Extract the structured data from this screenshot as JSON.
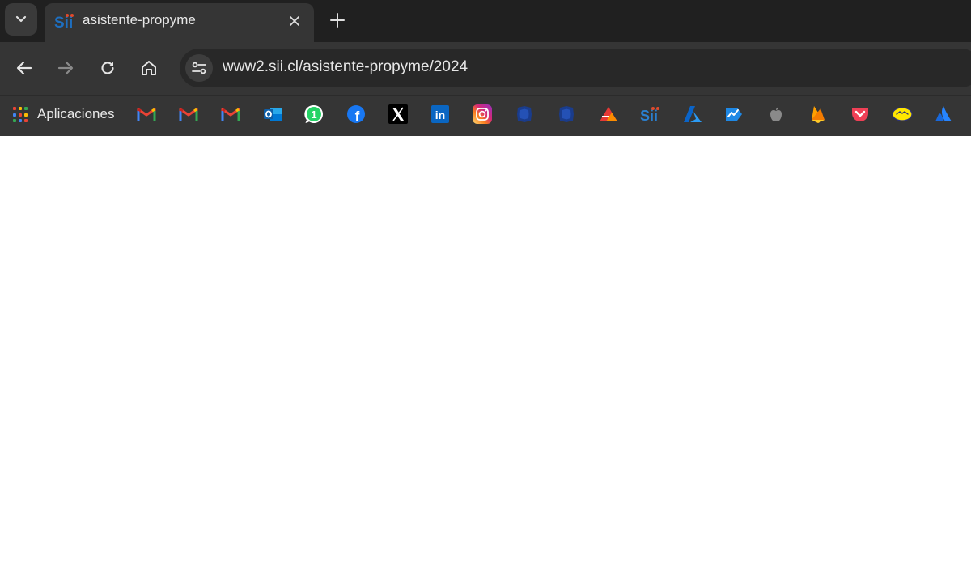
{
  "tab": {
    "title": "asistente-propyme",
    "favicon_text": "Sii"
  },
  "toolbar": {
    "url": "www2.sii.cl/asistente-propyme/2024"
  },
  "bookmarks": {
    "apps_label": "Aplicaciones",
    "items": [
      {
        "icon": "gmail-icon"
      },
      {
        "icon": "gmail-icon"
      },
      {
        "icon": "gmail-icon"
      },
      {
        "icon": "outlook-icon"
      },
      {
        "icon": "whatsapp-icon",
        "badge": "1"
      },
      {
        "icon": "facebook-icon",
        "text": "f"
      },
      {
        "icon": "x-icon",
        "text": "X"
      },
      {
        "icon": "linkedin-icon",
        "text": "in"
      },
      {
        "icon": "instagram-icon"
      },
      {
        "icon": "bank-icon"
      },
      {
        "icon": "bank-icon"
      },
      {
        "icon": "red-orange-icon"
      },
      {
        "icon": "sii-icon",
        "text": "Sii"
      },
      {
        "icon": "azure-icon"
      },
      {
        "icon": "azure-boards-icon"
      },
      {
        "icon": "apple-icon"
      },
      {
        "icon": "firebase-icon"
      },
      {
        "icon": "pocket-icon"
      },
      {
        "icon": "mercadolibre-icon"
      },
      {
        "icon": "atlassian-icon"
      }
    ]
  },
  "colors": {
    "tab_strip": "#202020",
    "toolbar": "#353535",
    "omnibox": "#282828",
    "page": "#ffffff"
  }
}
